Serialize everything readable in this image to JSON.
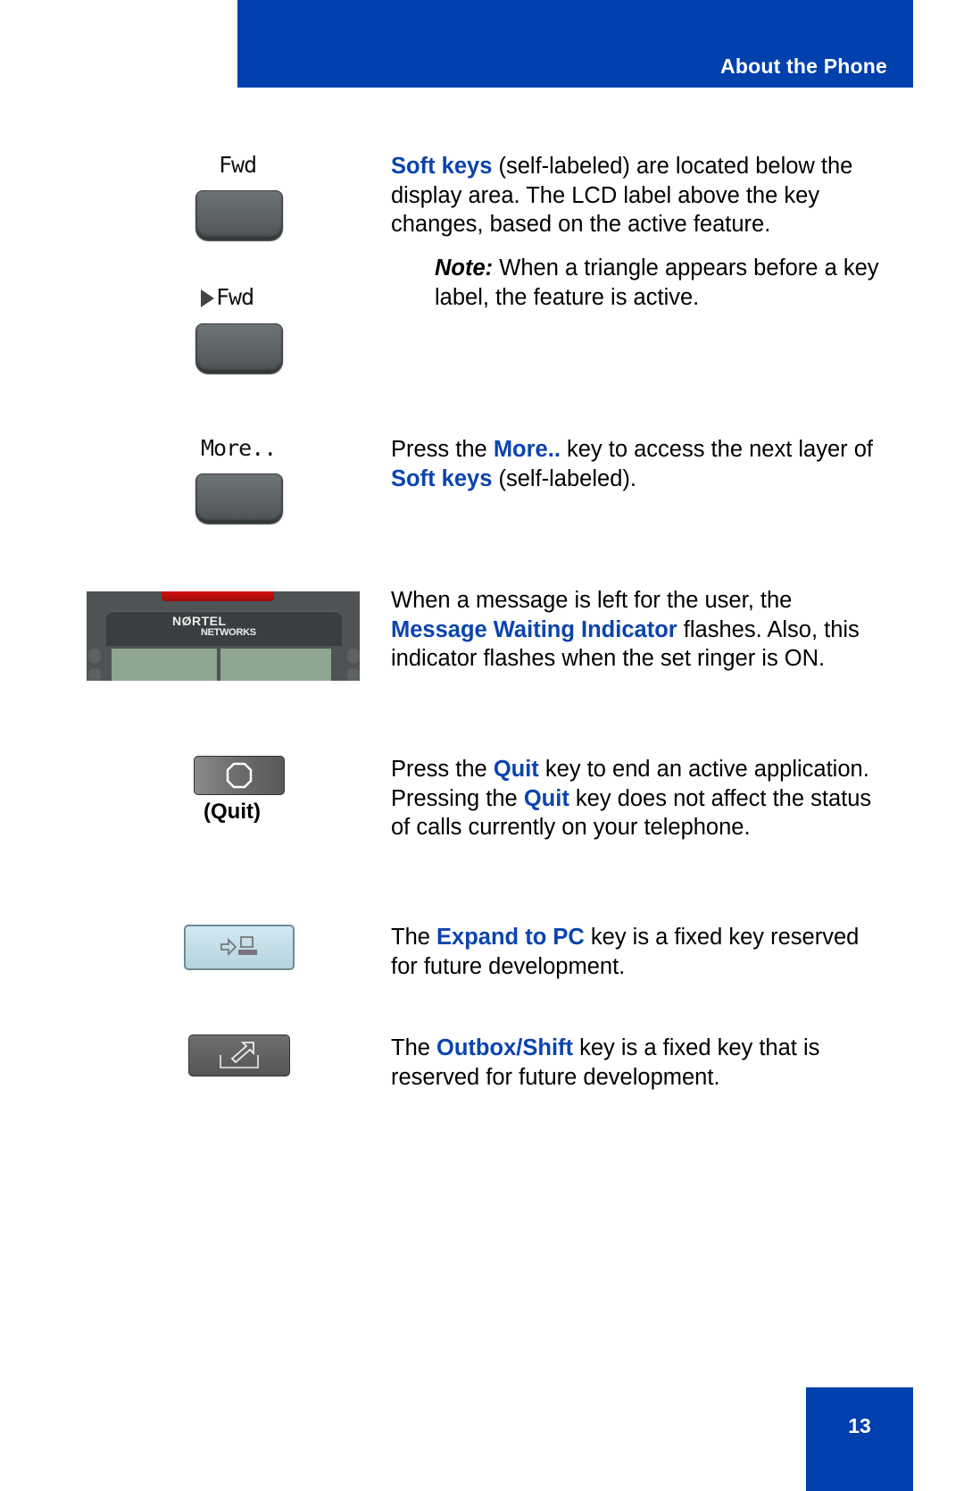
{
  "header": {
    "title": "About the Phone",
    "color": "#0240ad"
  },
  "footer": {
    "page_number": "13"
  },
  "sections": {
    "soft_keys": {
      "lcd_label_inactive": "Fwd",
      "lcd_label_active": "Fwd",
      "text_highlight": "Soft keys",
      "text_rest": " (self-labeled) are located below the display area. The LCD label above the key changes, based on the active feature.",
      "note_label": "Note:",
      "note_text": " When a triangle appears before a key label, the feature is active."
    },
    "more": {
      "lcd_label": "More..",
      "t1": "Press the ",
      "h1": "More..",
      "t2": " key to access the next layer of ",
      "h2": "Soft keys",
      "t3": " (self-labeled)."
    },
    "mwi": {
      "brand_line1": "NØRTEL",
      "brand_line2": "NETWORKS",
      "t1": "When a message is left for the user, the ",
      "h1": "Message Waiting Indicator",
      "t2": " flashes. Also, this indicator flashes when the set ringer is ON."
    },
    "quit": {
      "key_caption": "(Quit)",
      "t1": "Press the ",
      "h1": "Quit",
      "t2": " key to end an active application. Pressing the ",
      "h2": "Quit",
      "t3": " key does not affect the status of calls currently on your telephone."
    },
    "expand": {
      "t1": "The ",
      "h1": "Expand to PC",
      "t2": " key is a fixed key reserved for future development."
    },
    "outbox": {
      "t1": "The ",
      "h1": "Outbox/Shift",
      "t2": " key is a fixed key that is reserved for future development."
    }
  },
  "icons": {
    "triangle": "active-triangle-icon",
    "stop": "octagon-stop-icon",
    "expand": "arrow-to-pc-icon",
    "outbox": "outbox-arrow-icon"
  }
}
